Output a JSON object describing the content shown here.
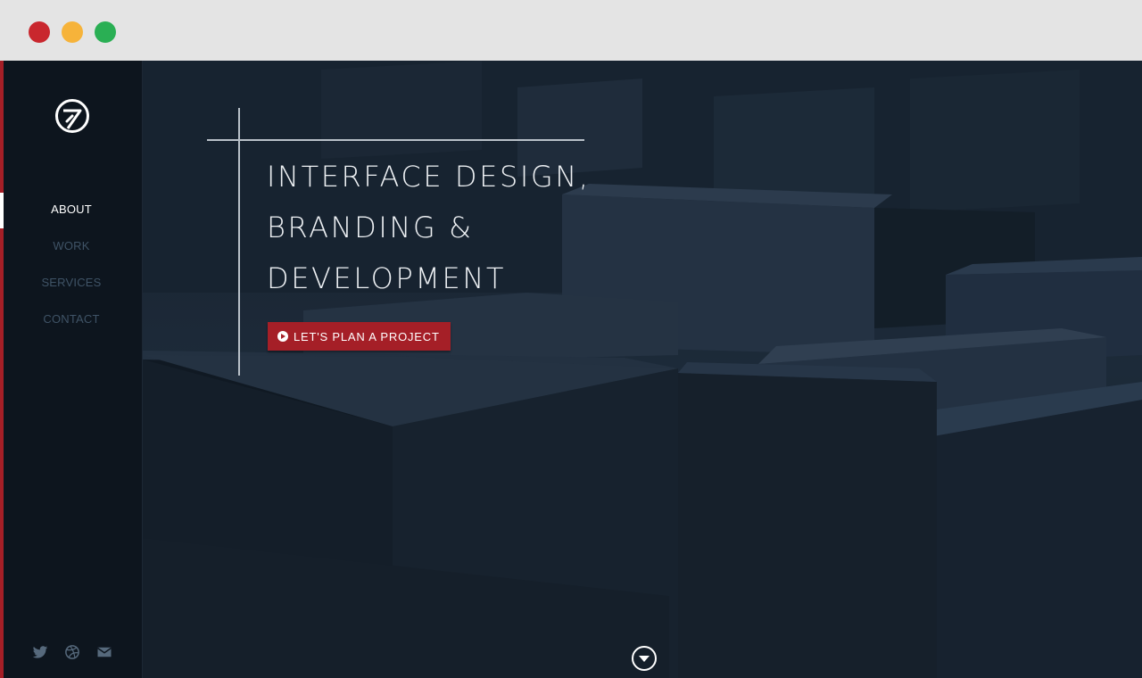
{
  "window": {
    "controls": {
      "close_color": "#c9272e",
      "minimize_color": "#f6b33a",
      "maximize_color": "#2aaf54"
    }
  },
  "theme": {
    "accent": "#a51f27",
    "sidebar_bg": "#0d151e",
    "text_muted": "#3f5366"
  },
  "sidebar": {
    "logo_icon": "brand-circle-7-icon",
    "nav": [
      {
        "label": "ABOUT",
        "active": true
      },
      {
        "label": "WORK",
        "active": false
      },
      {
        "label": "SERVICES",
        "active": false
      },
      {
        "label": "CONTACT",
        "active": false
      }
    ],
    "socials": [
      "twitter-icon",
      "dribbble-icon",
      "mail-icon"
    ]
  },
  "hero": {
    "headline": [
      "INTERFACE DESIGN,",
      "BRANDING &",
      "DEVELOPMENT"
    ],
    "cta": {
      "label": "LET'S PLAN A PROJECT",
      "icon": "play-circle-icon"
    },
    "scroll_icon": "scroll-down-icon"
  }
}
